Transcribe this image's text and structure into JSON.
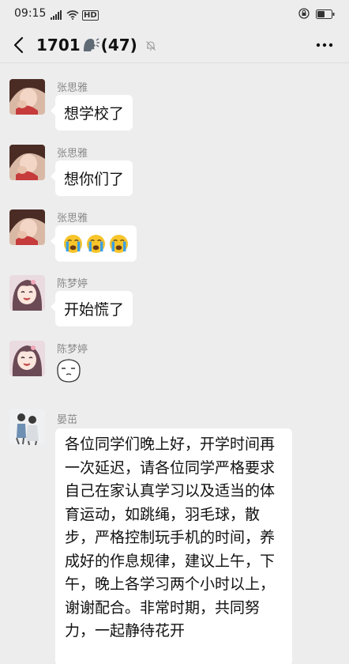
{
  "status_bar": {
    "time": "09:15",
    "network_label": "HD"
  },
  "nav": {
    "title_prefix": "1701",
    "title_suffix": "(47)"
  },
  "messages": [
    {
      "sender": "张思雅",
      "text": "想学校了"
    },
    {
      "sender": "张思雅",
      "text": "想你们了"
    },
    {
      "sender": "张思雅",
      "emoji": [
        "crying-face",
        "crying-face",
        "crying-face"
      ]
    },
    {
      "sender": "陈梦婷",
      "text": "开始慌了"
    },
    {
      "sender": "陈梦婷",
      "sticker": "face-sticker"
    },
    {
      "sender": "晏茁",
      "text": "各位同学们晚上好，开学时间再一次延迟，请各位同学严格要求自己在家认真学习以及适当的体育运动，如跳绳，羽毛球，散步，严格控制玩手机的时间，养成好的作息规律，建议上午，下午，晚上各学习两个小时以上，谢谢配合。非常时期，共同努力，一起静待花开"
    }
  ],
  "colors": {
    "background": "#ededed",
    "bubble": "#ffffff",
    "sender_name": "#8a8a8a",
    "emoji_yellow": "#f7c52b",
    "emoji_tears": "#3aa0e6"
  }
}
